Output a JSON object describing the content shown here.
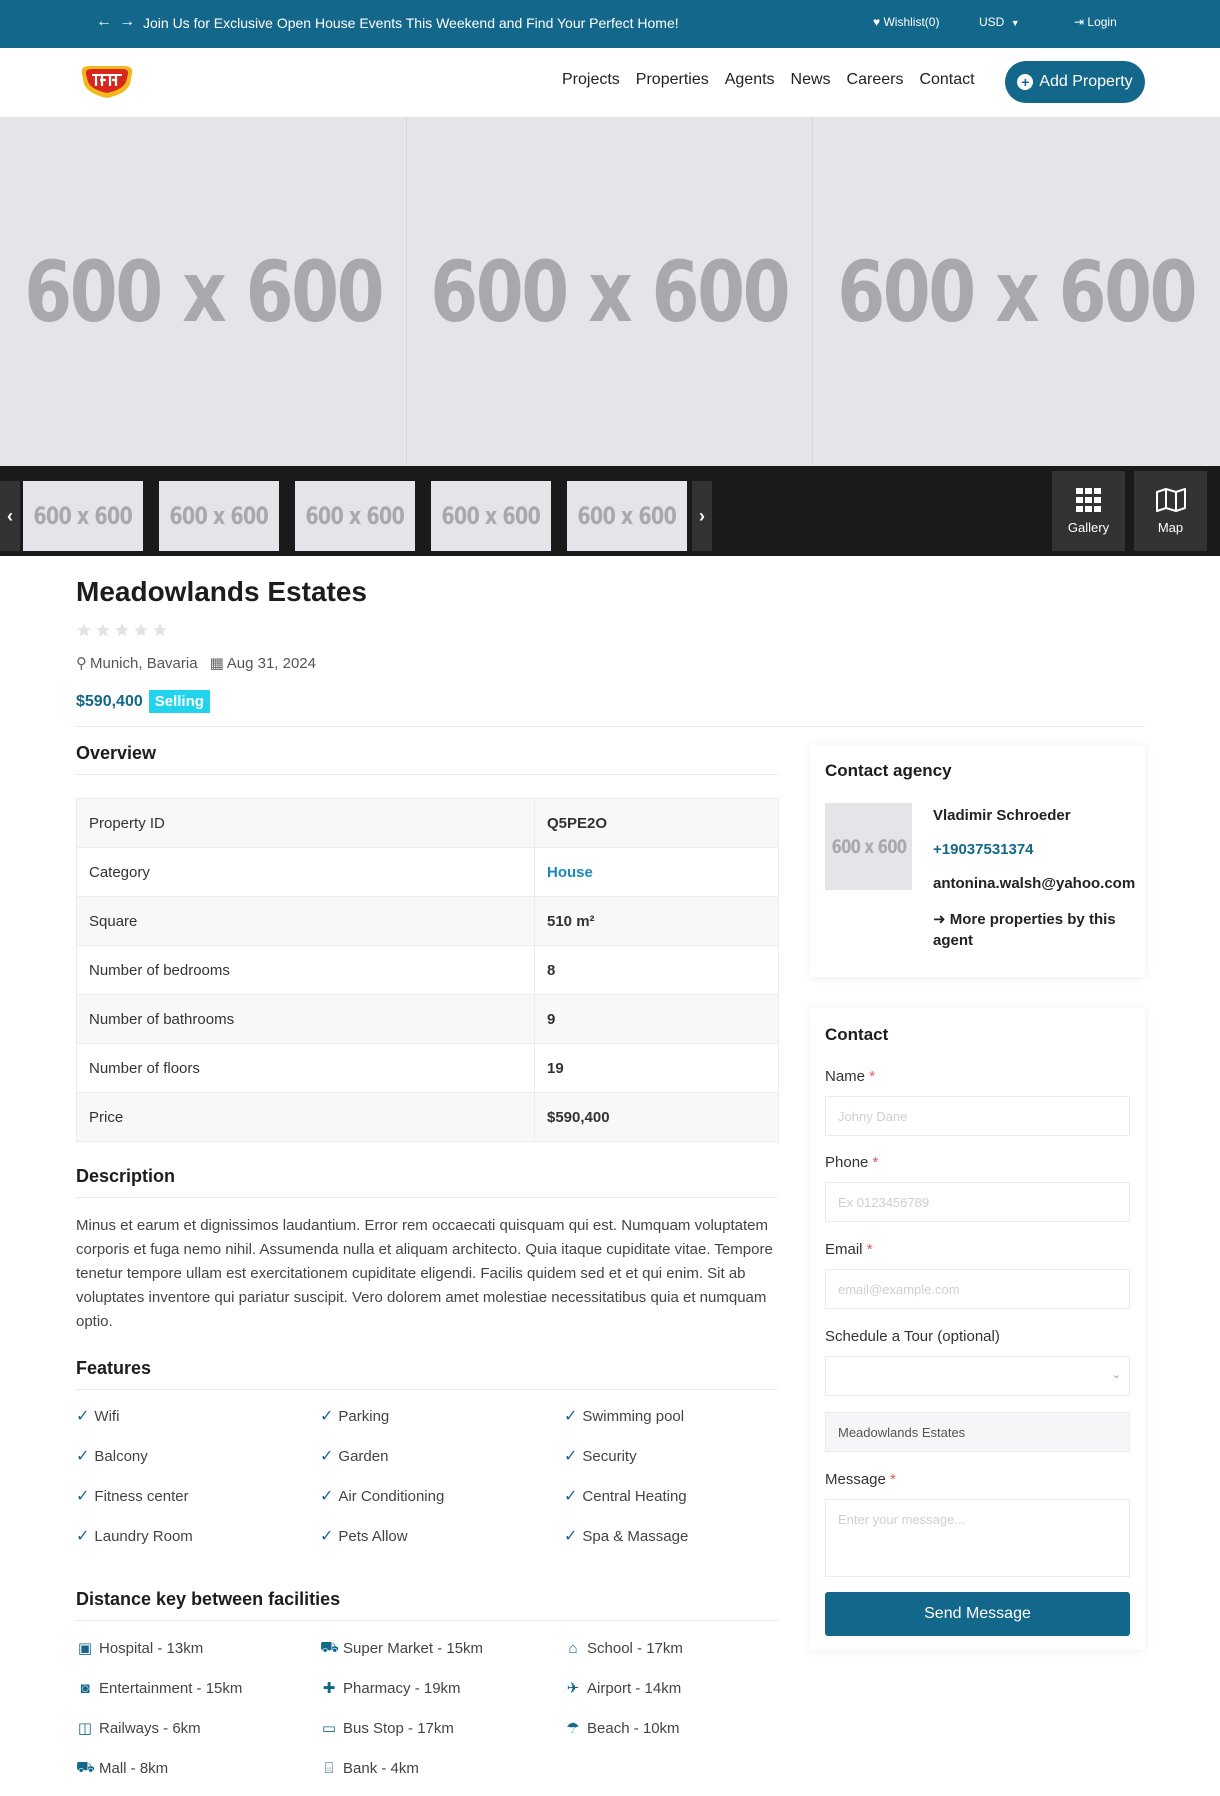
{
  "colors": {
    "primary": "#13678a",
    "badge": "#22d3ee",
    "link": "#1a8bb7"
  },
  "topbar": {
    "announcement": "Join Us for Exclusive Open House Events This Weekend and Find Your Perfect Home!",
    "wishlist": "Wishlist(0)",
    "currency": "USD",
    "login": "Login"
  },
  "header": {
    "nav": [
      "Projects",
      "Properties",
      "Agents",
      "News",
      "Careers",
      "Contact"
    ],
    "add_property": "Add Property"
  },
  "gallery": {
    "hero_images": [
      "600 x 600",
      "600 x 600",
      "600 x 600"
    ],
    "thumbnails": [
      "600 x 600",
      "600 x 600",
      "600 x 600",
      "600 x 600",
      "600 x 600"
    ],
    "gallery_label": "Gallery",
    "map_label": "Map"
  },
  "property": {
    "title": "Meadowlands Estates",
    "rating": 0,
    "location": "Munich, Bavaria",
    "date": "Aug 31, 2024",
    "price": "$590,400",
    "status": "Selling"
  },
  "overview": {
    "title": "Overview",
    "rows": [
      {
        "label": "Property ID",
        "value": "Q5PE2O"
      },
      {
        "label": "Category",
        "value": "House"
      },
      {
        "label": "Square",
        "value": "510 m²"
      },
      {
        "label": "Number of bedrooms",
        "value": "8"
      },
      {
        "label": "Number of bathrooms",
        "value": "9"
      },
      {
        "label": "Number of floors",
        "value": "19"
      },
      {
        "label": "Price",
        "value": "$590,400"
      }
    ]
  },
  "description": {
    "title": "Description",
    "text": "Minus et earum et dignissimos laudantium. Error rem occaecati quisquam qui est. Numquam voluptatem corporis et fuga nemo nihil. Assumenda nulla et aliquam architecto. Quia itaque cupiditate vitae. Tempore tenetur tempore ullam est exercitationem cupiditate eligendi. Facilis quidem sed et et qui enim. Sit ab voluptates inventore qui pariatur suscipit. Vero dolorem amet molestiae necessitatibus quia et numquam optio."
  },
  "features": {
    "title": "Features",
    "items": [
      "Wifi",
      "Parking",
      "Swimming pool",
      "Balcony",
      "Garden",
      "Security",
      "Fitness center",
      "Air Conditioning",
      "Central Heating",
      "Laundry Room",
      "Pets Allow",
      "Spa & Massage"
    ]
  },
  "facilities": {
    "title": "Distance key between facilities",
    "items": [
      {
        "icon": "hospital-icon",
        "label": "Hospital - 13km"
      },
      {
        "icon": "cart-icon",
        "label": "Super Market - 15km"
      },
      {
        "icon": "school-icon",
        "label": "School - 17km"
      },
      {
        "icon": "entertainment-icon",
        "label": "Entertainment - 15km"
      },
      {
        "icon": "pharmacy-icon",
        "label": "Pharmacy - 19km"
      },
      {
        "icon": "plane-icon",
        "label": "Airport - 14km"
      },
      {
        "icon": "train-icon",
        "label": "Railways - 6km"
      },
      {
        "icon": "bus-icon",
        "label": "Bus Stop - 17km"
      },
      {
        "icon": "umbrella-beach-icon",
        "label": "Beach - 10km"
      },
      {
        "icon": "cart-icon",
        "label": "Mall - 8km"
      },
      {
        "icon": "bank-icon",
        "label": "Bank - 4km"
      }
    ]
  },
  "agency": {
    "title": "Contact agency",
    "photo": "600 x 600",
    "name": "Vladimir Schroeder",
    "phone": "+19037531374",
    "email": "antonina.walsh@yahoo.com",
    "more": "More properties by this agent"
  },
  "contact_form": {
    "title": "Contact",
    "name_label": "Name",
    "name_placeholder": "Johny Dane",
    "phone_label": "Phone",
    "phone_placeholder": "Ex 0123456789",
    "email_label": "Email",
    "email_placeholder": "email@example.com",
    "tour_label": "Schedule a Tour (optional)",
    "property_value": "Meadowlands Estates",
    "message_label": "Message",
    "message_placeholder": "Enter your message...",
    "required_mark": "*",
    "submit": "Send Message"
  }
}
